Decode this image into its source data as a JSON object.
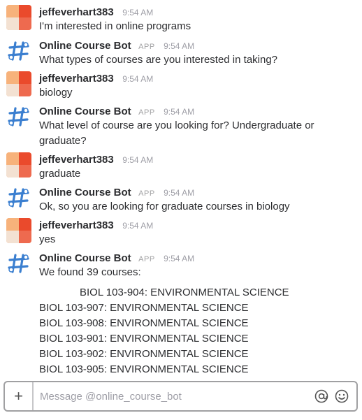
{
  "messages": [
    {
      "sender": "jeffeverhart383",
      "is_bot": false,
      "app_tag": "",
      "time": "9:54 AM",
      "lines": [
        "I'm interested in online programs"
      ]
    },
    {
      "sender": "Online Course Bot",
      "is_bot": true,
      "app_tag": "APP",
      "time": "9:54 AM",
      "lines": [
        "What types of courses are you interested in taking?"
      ]
    },
    {
      "sender": "jeffeverhart383",
      "is_bot": false,
      "app_tag": "",
      "time": "9:54 AM",
      "lines": [
        "biology"
      ]
    },
    {
      "sender": "Online Course Bot",
      "is_bot": true,
      "app_tag": "APP",
      "time": "9:54 AM",
      "lines": [
        "What level of course are you looking for? Undergraduate or",
        "graduate?"
      ]
    },
    {
      "sender": "jeffeverhart383",
      "is_bot": false,
      "app_tag": "",
      "time": "9:54 AM",
      "lines": [
        "graduate"
      ]
    },
    {
      "sender": "Online Course Bot",
      "is_bot": true,
      "app_tag": "APP",
      "time": "9:54 AM",
      "lines": [
        "Ok, so you are looking for graduate courses in biology"
      ]
    },
    {
      "sender": "jeffeverhart383",
      "is_bot": false,
      "app_tag": "",
      "time": "9:54 AM",
      "lines": [
        "yes"
      ]
    },
    {
      "sender": "Online Course Bot",
      "is_bot": true,
      "app_tag": "APP",
      "time": "9:54 AM",
      "lines": [
        "We found 39 courses:"
      ]
    }
  ],
  "courses": [
    "BIOL 103-904: ENVIRONMENTAL SCIENCE",
    "BIOL 103-907: ENVIRONMENTAL SCIENCE",
    "BIOL 103-908: ENVIRONMENTAL SCIENCE",
    "BIOL 103-901: ENVIRONMENTAL SCIENCE",
    "BIOL 103-902: ENVIRONMENTAL SCIENCE",
    "BIOL 103-905: ENVIRONMENTAL SCIENCE"
  ],
  "composer": {
    "placeholder": "Message @online_course_bot",
    "plus_label": "+",
    "mention_icon": "at-icon",
    "emoji_icon": "emoji-icon"
  },
  "colors": {
    "user_avatar": [
      "#f7b27b",
      "#ea4a2c",
      "#f3e1d2",
      "#ee6a4f"
    ],
    "bot_avatar": "#3b7fd0",
    "text": "#2c2d30",
    "muted": "#9e9ea6"
  }
}
